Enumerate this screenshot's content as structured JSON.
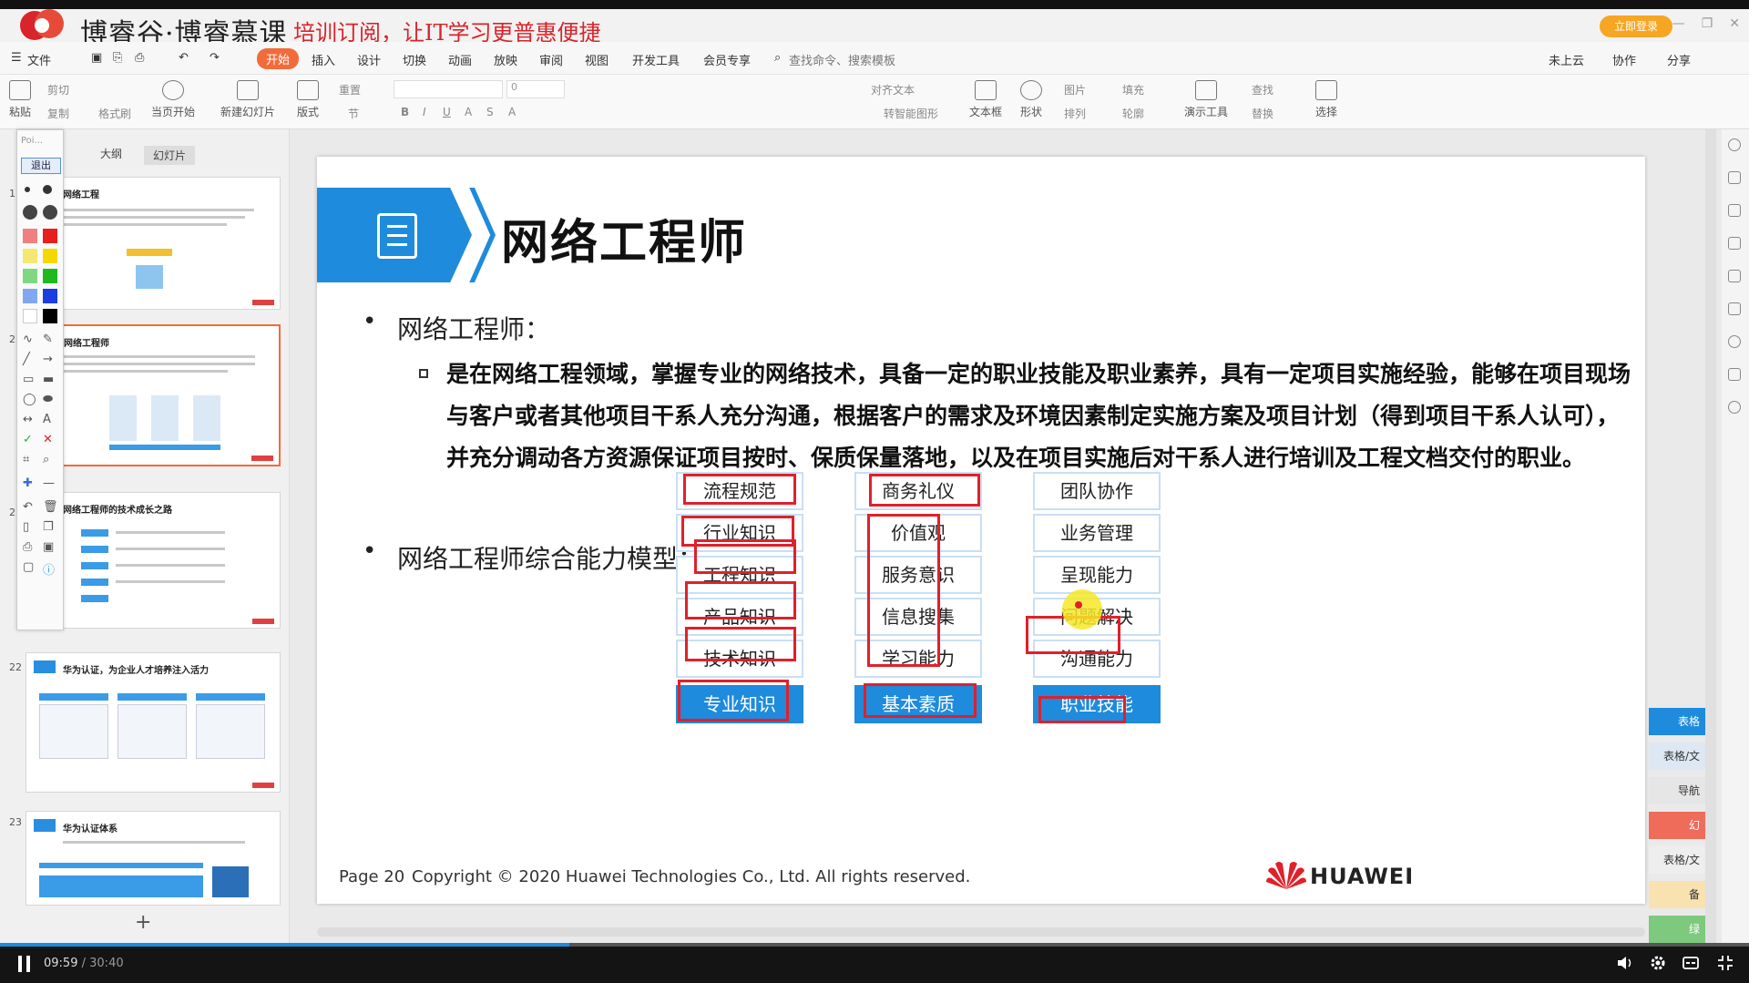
{
  "banner": {
    "brand": "博睿谷·博睿慕课",
    "slogan": "培训订阅，让IT学习更普惠便捷",
    "login": "立即登录"
  },
  "menu": {
    "file": "文件",
    "tabs": [
      "开始",
      "插入",
      "设计",
      "切换",
      "动画",
      "放映",
      "审阅",
      "视图",
      "开发工具",
      "会员专享"
    ],
    "search": "查找命令、搜索模板",
    "right": [
      "未上云",
      "协作",
      "分享"
    ]
  },
  "ribbon": {
    "paste": "粘贴",
    "cut": "剪切",
    "copy": "复制",
    "format_painter": "格式刷",
    "play_from_start": "当页开始",
    "new_slide": "新建幻灯片",
    "layout": "版式",
    "section": "节",
    "reset": "重置",
    "font_size": "0",
    "text_box": "文本框",
    "shape": "形状",
    "picture": "图片",
    "arrange": "排列",
    "fill": "填充",
    "outline": "轮廓",
    "present_tool": "演示工具",
    "find": "查找",
    "replace": "替换",
    "select": "选择",
    "align_text": "对齐文本",
    "smartart": "转智能图形"
  },
  "left_pane": {
    "tab_outline": "大纲",
    "tab_slides": "幻灯片",
    "thumbs": [
      {
        "num": "1",
        "title": "网络工程"
      },
      {
        "num": "2",
        "title": "网络工程师"
      },
      {
        "num": "2",
        "title": "网络工程师的技术成长之路"
      },
      {
        "num": "22",
        "title": "华为认证，为企业人才培养注入活力"
      },
      {
        "num": "23",
        "title": "华为认证体系"
      }
    ]
  },
  "pen_bar": {
    "pointer": "Poi...",
    "exit": "退出"
  },
  "slide": {
    "title": "网络工程师",
    "bullet1": "网络工程师：",
    "paragraph": "是在网络工程领域，掌握专业的网络技术，具备一定的职业技能及职业素养，具有一定项目实施经验，能够在项目现场与客户或者其他项目干系人充分沟通，根据客户的需求及环境因素制定实施方案及项目计划（得到项目干系人认可），并充分调动各方资源保证项目按时、保质保量落地，以及在项目实施后对干系人进行培训及工程文档交付的职业。",
    "bullet2": "网络工程师综合能力模型：",
    "model": {
      "col1": [
        "流程规范",
        "行业知识",
        "工程知识",
        "产品知识",
        "技术知识"
      ],
      "col1_footer": "专业知识",
      "col2": [
        "商务礼仪",
        "价值观",
        "服务意识",
        "信息搜集",
        "学习能力"
      ],
      "col2_footer": "基本素质",
      "col3": [
        "团队协作",
        "业务管理",
        "呈现能力",
        "问题解决",
        "沟通能力"
      ],
      "col3_footer": "职业技能"
    },
    "page": "Page 20",
    "copyright": "Copyright © 2020 Huawei Technologies Co., Ltd. All rights reserved.",
    "logo_text": "HUAWEI"
  },
  "right_panel": {
    "tabs": [
      "表格",
      "表格/文",
      "导航",
      "幻",
      "表格/文",
      "备",
      "绿"
    ]
  },
  "player": {
    "current": "09:59",
    "separator": "/",
    "total": "30:40",
    "progress": 0.3254
  },
  "colors": {
    "accent": "#1e8bdc",
    "annotation": "#e0202a",
    "brand_red": "#d8242a"
  }
}
